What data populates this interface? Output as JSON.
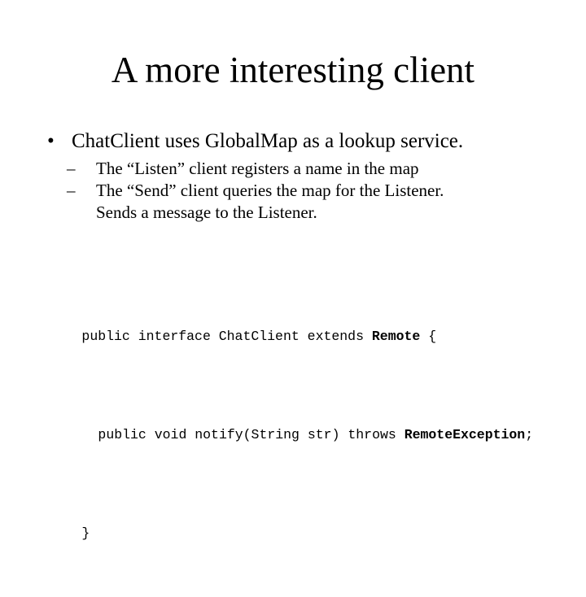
{
  "slide": {
    "title": "A more interesting client",
    "background_color": "#ffffff",
    "text_color": "#000000"
  },
  "bullets": {
    "level1_marker": "•",
    "level2_marker": "–",
    "items": [
      {
        "text": "ChatClient uses GlobalMap as a lookup service.",
        "children": [
          {
            "line1": "The “Listen” client registers a name in the map",
            "line2": ""
          },
          {
            "line1": "The “Send” client queries the map for the Listener.",
            "line2": "Sends a message to the Listener."
          }
        ]
      }
    ]
  },
  "code": {
    "line1": {
      "before": "public interface ChatClient extends ",
      "bold": "Remote",
      "after": " {"
    },
    "line2": {
      "before": "public void notify(String str) throws ",
      "bold": "RemoteException",
      "after": ";"
    },
    "line3": {
      "before": "}",
      "bold": "",
      "after": ""
    }
  }
}
